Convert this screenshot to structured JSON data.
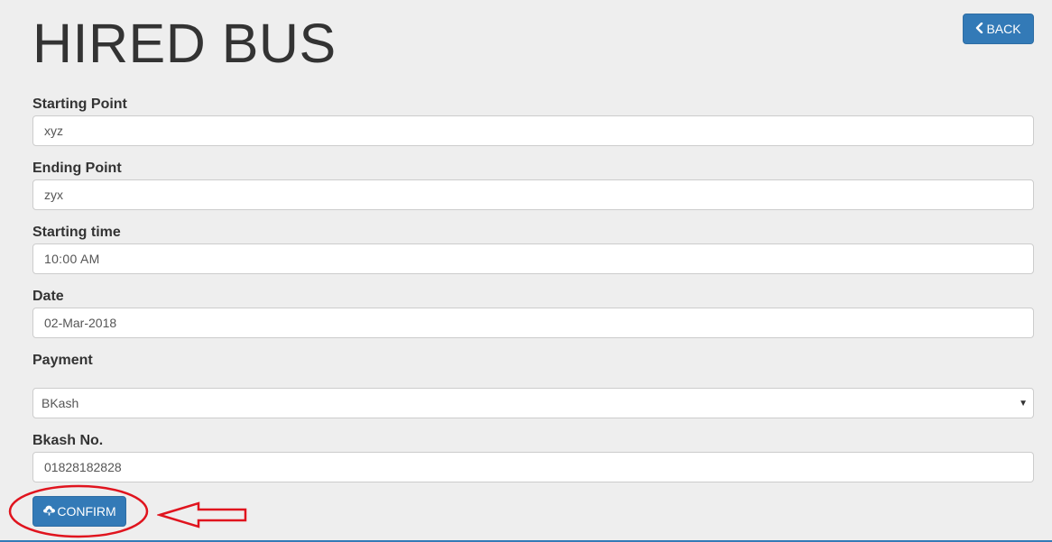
{
  "header": {
    "title": "HIRED BUS",
    "back_label": "BACK"
  },
  "form": {
    "starting_point": {
      "label": "Starting Point",
      "value": "xyz"
    },
    "ending_point": {
      "label": "Ending Point",
      "value": "zyx"
    },
    "starting_time": {
      "label": "Starting time",
      "value": "10:00 AM"
    },
    "date": {
      "label": "Date",
      "value": "02-Mar-2018"
    },
    "payment": {
      "label": "Payment",
      "selected": "BKash"
    },
    "bkash_no": {
      "label": "Bkash No.",
      "value": "01828182828"
    },
    "confirm_label": "CONFIRM"
  },
  "colors": {
    "primary": "#337ab7",
    "background": "#eeeeee",
    "annotation": "#e0141e"
  },
  "icons": {
    "back": "chevron-left-icon",
    "confirm": "cloud-upload-icon"
  }
}
